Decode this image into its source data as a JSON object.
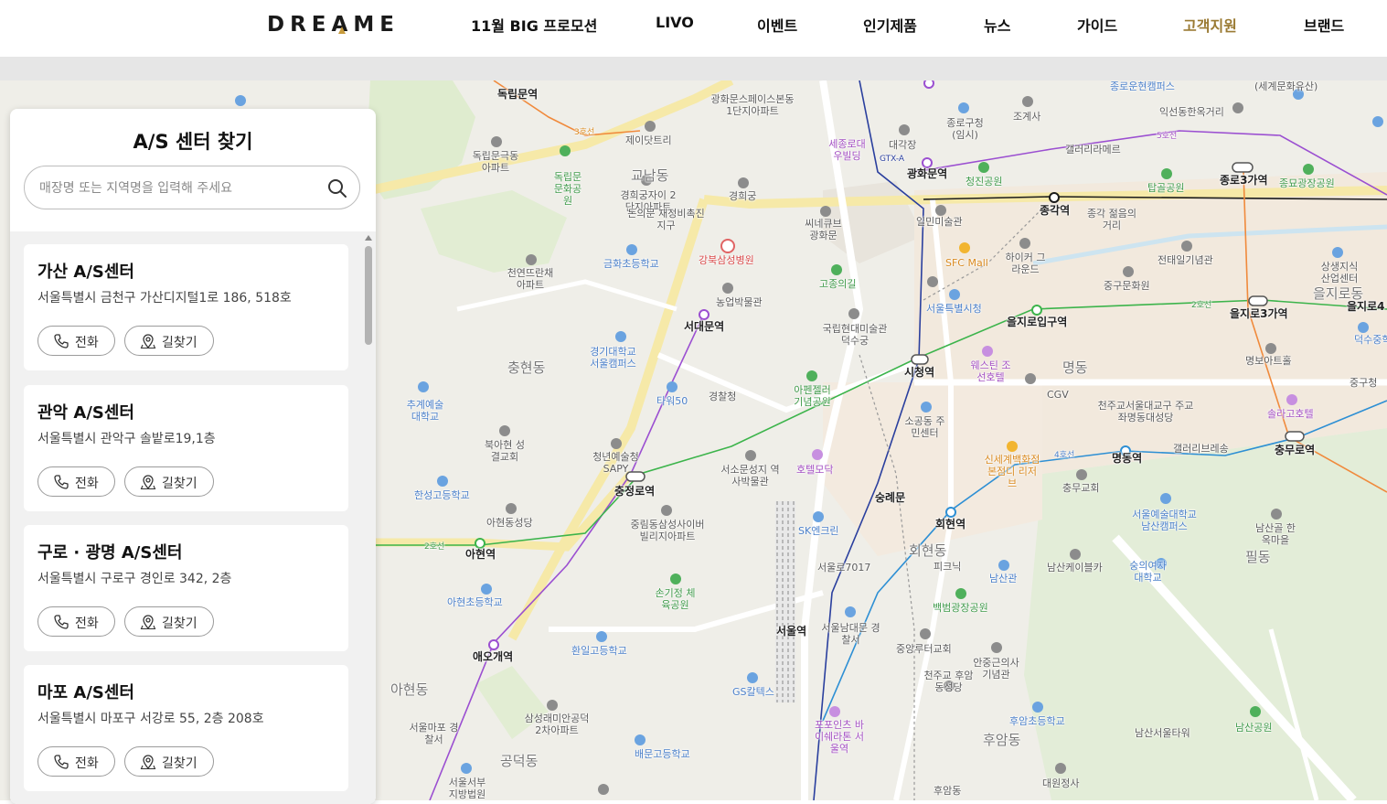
{
  "header": {
    "logo": "DREAME",
    "nav": [
      {
        "label": "11월 BIG 프로모션",
        "active": false
      },
      {
        "label": "LIVO",
        "active": false
      },
      {
        "label": "이벤트",
        "active": false
      },
      {
        "label": "인기제품",
        "active": false
      },
      {
        "label": "뉴스",
        "active": false
      },
      {
        "label": "가이드",
        "active": false
      },
      {
        "label": "고객지원",
        "active": true
      },
      {
        "label": "브랜드",
        "active": false
      }
    ],
    "active_color": "#9a7a33"
  },
  "panel": {
    "title": "A/S 센터 찾기",
    "search_placeholder": "매장명 또는 지역명을 입력해 주세요",
    "centers": [
      {
        "name": "가산 A/S센터",
        "address": "서울특별시 금천구 가산디지털1로 186, 518호",
        "call_label": "전화",
        "route_label": "길찾기"
      },
      {
        "name": "관악 A/S센터",
        "address": "서울특별시 관악구 솔밭로19,1층",
        "call_label": "전화",
        "route_label": "길찾기"
      },
      {
        "name": "구로 · 광명 A/S센터",
        "address": "서울특별시 구로구 경인로 342, 2층",
        "call_label": "전화",
        "route_label": "길찾기"
      },
      {
        "name": "마포 A/S센터",
        "address": "서울특별시 마포구 서강로 55, 2층 208호",
        "call_label": "전화",
        "route_label": "길찾기"
      }
    ]
  },
  "map": {
    "labels": {
      "stations": [
        "독립문역",
        "광화문역",
        "종각역",
        "종로3가역",
        "서대문역",
        "을지로입구역",
        "을지로3가역",
        "시청역",
        "충정로역",
        "아현역",
        "회현역",
        "명동역",
        "충무로역",
        "애오개역",
        "서울역",
        "을지로4"
      ],
      "districts": [
        "충현동",
        "아현동",
        "명동",
        "회현동",
        "필동",
        "후암동",
        "공덕동",
        "교남동",
        "을지로동"
      ],
      "places": [
        "광화문스페이스본동 1단지아파트",
        "종로구청(임시)",
        "조계사",
        "익선동한옥거리",
        "세종로대우빌딩",
        "대각장",
        "청진공원",
        "갤러리라메르",
        "탑골공원",
        "종묘광장공원",
        "종로운현캠퍼스",
        "(세계문화유산)",
        "독립문극동 아파트",
        "독립문 문화공원",
        "제이닷트리",
        "경희궁자이 2단지아파트",
        "돈의문 재정비촉진지구",
        "경희궁",
        "씨네큐브 광화문",
        "일민미술관",
        "종각 젊음의거리",
        "하이커 그라운드",
        "SFC Mall",
        "전태일기념관",
        "상생지식 산업센터",
        "천연뜨란채 아파트",
        "금화초등학교",
        "강북삼성병원",
        "농업박물관",
        "고종의길",
        "국립현대미술관 덕수궁",
        "서울특별시청",
        "웨스틴 조선호텔",
        "CGV",
        "중구문화원",
        "덕수중학교",
        "명보아트홀",
        "중구청",
        "경기대학교 서울캠퍼스",
        "타워50",
        "경찰청",
        "아펜젤러 기념공원",
        "소공동 주민센터",
        "천주교서울대교구 주교좌명동대성당",
        "솔라고호텔",
        "추계예술 대학교",
        "북아현 성결교회",
        "청년예술청 SAPY",
        "서소문성지 역사박물관",
        "호텔모닥",
        "신세계백화점 본점디 리저브",
        "갤러리브레송",
        "충무교회",
        "한성고등학교",
        "아현동성당",
        "중림동삼성사이버 빌리지아파트",
        "SK엔크린",
        "숭례문",
        "서울예술대학교 남산캠퍼스",
        "남산골 한옥마을",
        "피크닉",
        "남산관",
        "남산케이블카",
        "숭의여자 대학교",
        "아현초등학교",
        "손기정 체육공원",
        "서울로7017",
        "백범광장공원",
        "서울남대문 경찰서",
        "중앙루터교회",
        "안중근의사 기념관",
        "환일고등학교",
        "GS칼텍스",
        "천주교 후암동성당",
        "후암초등학교",
        "남산서울타워",
        "남산공원",
        "삼성래미안공덕 2차아파트",
        "서울마포 경찰서",
        "배문고등학교",
        "포포인츠 바이쉐라톤 서울역",
        "서울서부 지방법원",
        "대원정사",
        "후암동"
      ],
      "lines": [
        "3호선",
        "5호선",
        "2호선",
        "4호선",
        "GTX-A"
      ]
    }
  }
}
